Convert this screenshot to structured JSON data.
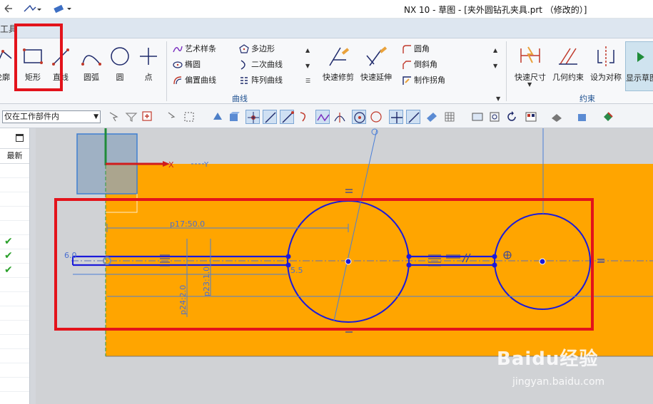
{
  "window": {
    "title": "NX 10 - 草图 - [夹外圆钻孔夹具.prt （修改的）]"
  },
  "tabbar": {
    "tools_tab": "工具"
  },
  "ribbon": {
    "curve_group": {
      "label": "曲线",
      "big_buttons": [
        {
          "label": "轮廓",
          "icon": "profile-icon"
        },
        {
          "label": "矩形",
          "icon": "rectangle-icon"
        },
        {
          "label": "直线",
          "icon": "line-icon"
        },
        {
          "label": "圆弧",
          "icon": "arc-icon"
        },
        {
          "label": "圆",
          "icon": "circle-icon"
        },
        {
          "label": "点",
          "icon": "point-icon"
        }
      ],
      "small_col1": [
        "艺术样条",
        "椭圆",
        "偏置曲线"
      ],
      "small_col2": [
        "多边形",
        "二次曲线",
        "阵列曲线"
      ],
      "edit_buttons": [
        "快速修剪",
        "快速延伸"
      ],
      "small_col3": [
        "圆角",
        "倒斜角",
        "制作拐角"
      ]
    },
    "constraint_group": {
      "label": "约束",
      "buttons": [
        "快速尺寸",
        "几何约束",
        "设为对称",
        "显示草图"
      ]
    }
  },
  "toolbar2": {
    "filter_value": "仅在工作部件内"
  },
  "left_panel": {
    "header": "最新",
    "checks": 3
  },
  "sketch": {
    "dimensions": {
      "p17": "p17:50.0",
      "p24": "p24:2.0",
      "p23": "p23:1.0",
      "d6": "6.0",
      "d5": "5.5"
    },
    "axis_labels": {
      "x": "X",
      "y": "Y"
    },
    "colors": {
      "part_face": "#ffa500",
      "sketch_curve": "#1a1adb",
      "highlight_box": "#e3131b"
    }
  },
  "watermark": {
    "brand": "Baidu经验",
    "url": "jingyan.baidu.com"
  }
}
